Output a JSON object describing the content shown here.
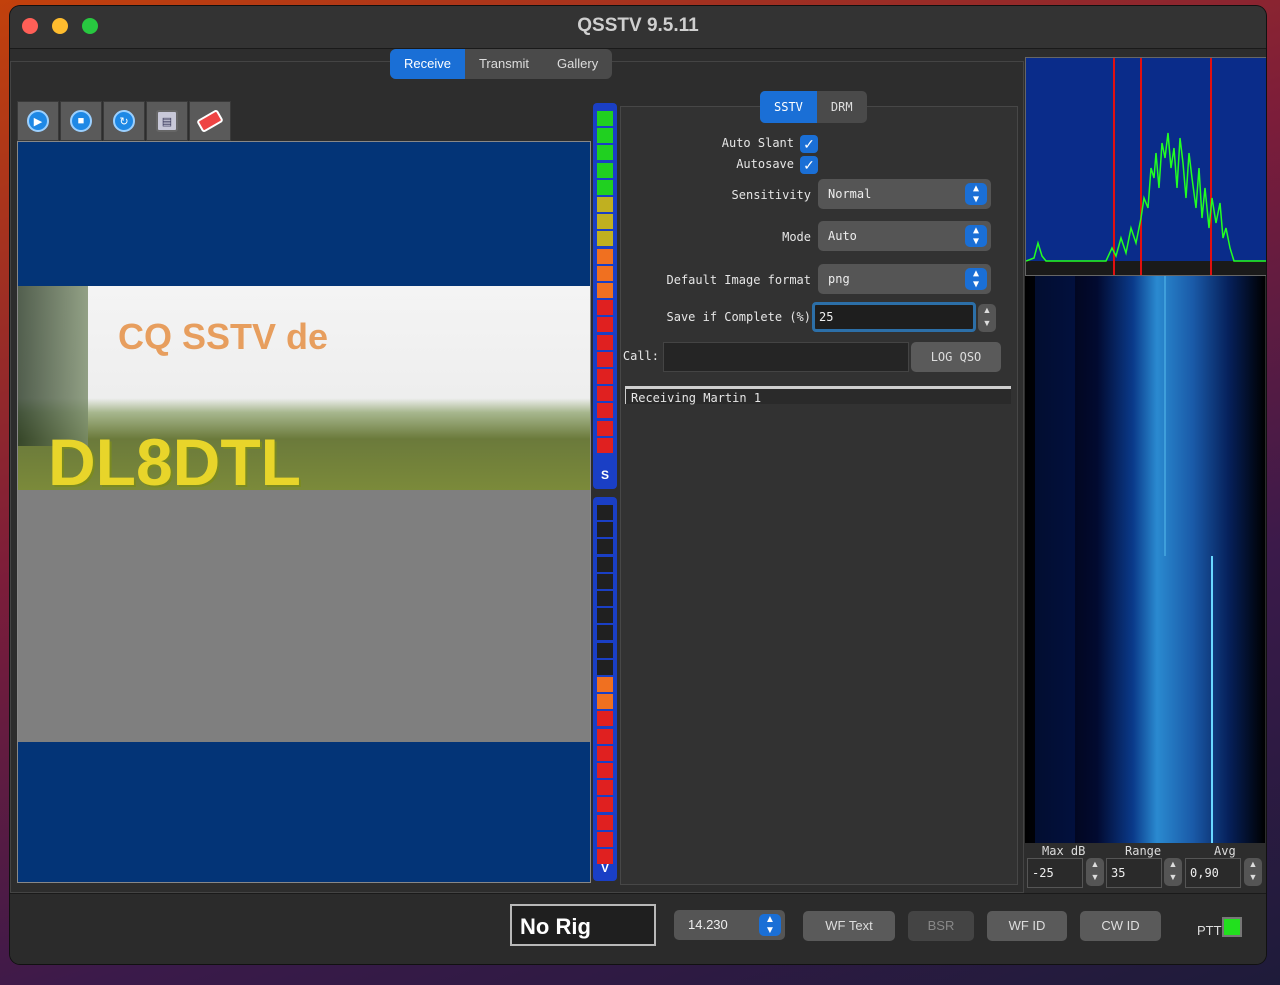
{
  "window": {
    "title": "QSSTV 9.5.11"
  },
  "tabs": [
    {
      "label": "Receive",
      "active": true
    },
    {
      "label": "Transmit",
      "active": false
    },
    {
      "label": "Gallery",
      "active": false
    }
  ],
  "toolbar": {
    "icons": [
      "play-icon",
      "stop-icon",
      "refresh-icon",
      "save-icon",
      "eraser-icon"
    ]
  },
  "image": {
    "overlay_text_top": "CQ SSTV de",
    "overlay_text_call": "DL8DTL"
  },
  "meters": {
    "signal_label": "S",
    "volume_label": "V"
  },
  "mode_tabs": [
    {
      "label": "SSTV",
      "active": true
    },
    {
      "label": "DRM",
      "active": false
    }
  ],
  "settings": {
    "auto_slant_label": "Auto Slant",
    "auto_slant_checked": true,
    "autosave_label": "Autosave",
    "autosave_checked": true,
    "sensitivity_label": "Sensitivity",
    "sensitivity_value": "Normal",
    "mode_label": "Mode",
    "mode_value": "Auto",
    "image_format_label": "Default Image format",
    "image_format_value": "png",
    "save_complete_label": "Save if Complete (%)",
    "save_complete_value": "25",
    "call_label": "Call:",
    "call_value": "",
    "log_qso_label": "LOG QSO"
  },
  "status": {
    "text": "Receiving Martin 1"
  },
  "waterfall": {
    "max_db_label": "Max dB",
    "max_db_value": "-25",
    "range_label": "Range",
    "range_value": "35",
    "avg_label": "Avg",
    "avg_value": "0,90"
  },
  "bottom": {
    "rig": "No Rig",
    "frequency": "14.230",
    "wf_text_label": "WF Text",
    "bsr_label": "BSR",
    "wf_id_label": "WF ID",
    "cw_id_label": "CW ID",
    "ptt_label": "PTT"
  },
  "colors": {
    "accent": "#1a6fd6",
    "ptt": "#22e01e",
    "image_bg": "#033477"
  }
}
